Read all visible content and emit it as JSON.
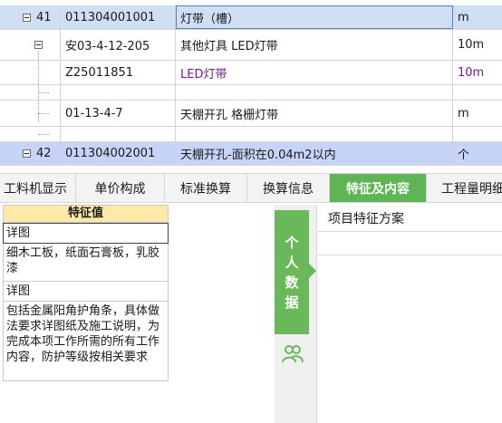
{
  "grid": {
    "rows": [
      {
        "num": "41",
        "code": "011304001001",
        "name": "灯带（槽）",
        "unit": "m",
        "style": "selected"
      },
      {
        "num": "",
        "code": "安03-4-12-205",
        "name": "其他灯具 LED灯带",
        "unit": "10m",
        "style": "normal"
      },
      {
        "num": "",
        "code": "Z25011851",
        "name": "LED灯带",
        "unit": "10m",
        "style": "purple"
      },
      {
        "num": "",
        "code": "",
        "name": "",
        "unit": "",
        "style": "normal"
      },
      {
        "num": "",
        "code": "01-13-4-7",
        "name": "天棚开孔 格栅灯带",
        "unit": "m",
        "style": "normal"
      },
      {
        "num": "",
        "code": "",
        "name": "",
        "unit": "",
        "style": "normal"
      },
      {
        "num": "42",
        "code": "011304002001",
        "name": "天棚开孔-面积在0.04m2以内",
        "unit": "个",
        "style": "blue"
      }
    ]
  },
  "tabs": [
    {
      "label": "工料机显示"
    },
    {
      "label": "单价构成"
    },
    {
      "label": "标准换算"
    },
    {
      "label": "换算信息"
    },
    {
      "label": "特征及内容",
      "active": true
    },
    {
      "label": "工程量明细"
    }
  ],
  "feature": {
    "header": "特征值",
    "values": [
      "详图",
      "细木工板，纸面石膏板，乳胶漆",
      "详图",
      "包括金属阳角护角条，具体做法要求详图纸及施工说明，为完成本项工作所需的所有工作内容，防护等级按相关要求"
    ]
  },
  "scheme": {
    "side_tab": [
      "个",
      "人",
      "数",
      "据"
    ],
    "title": "项目特征方案",
    "accent": "#69b95b",
    "people_icon": "people-icon"
  }
}
